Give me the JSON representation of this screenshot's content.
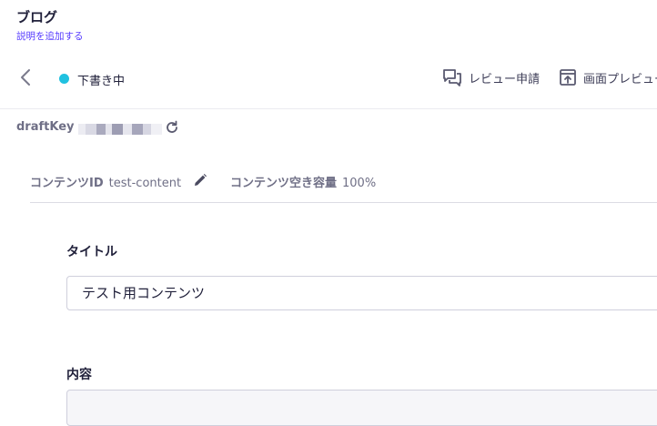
{
  "header": {
    "title": "ブログ",
    "description": "説明を追加する",
    "accent_color": "#563bff"
  },
  "status": {
    "label": "下書き中",
    "color": "#20c1e0"
  },
  "toolbar": {
    "review_label": "レビュー申請",
    "review_icon": "chat-bubbles-icon",
    "preview_label": "画面プレビュー",
    "preview_icon": "open-external-icon"
  },
  "draft": {
    "label": "draftKey",
    "refresh_icon": "refresh-icon"
  },
  "meta": {
    "content_id_label": "コンテンツID",
    "content_id_value": "test-content",
    "capacity_label": "コンテンツ空き容量",
    "capacity_value": "100%"
  },
  "form": {
    "title_label": "タイトル",
    "title_value": "テスト用コンテンツ",
    "body_label": "内容"
  }
}
